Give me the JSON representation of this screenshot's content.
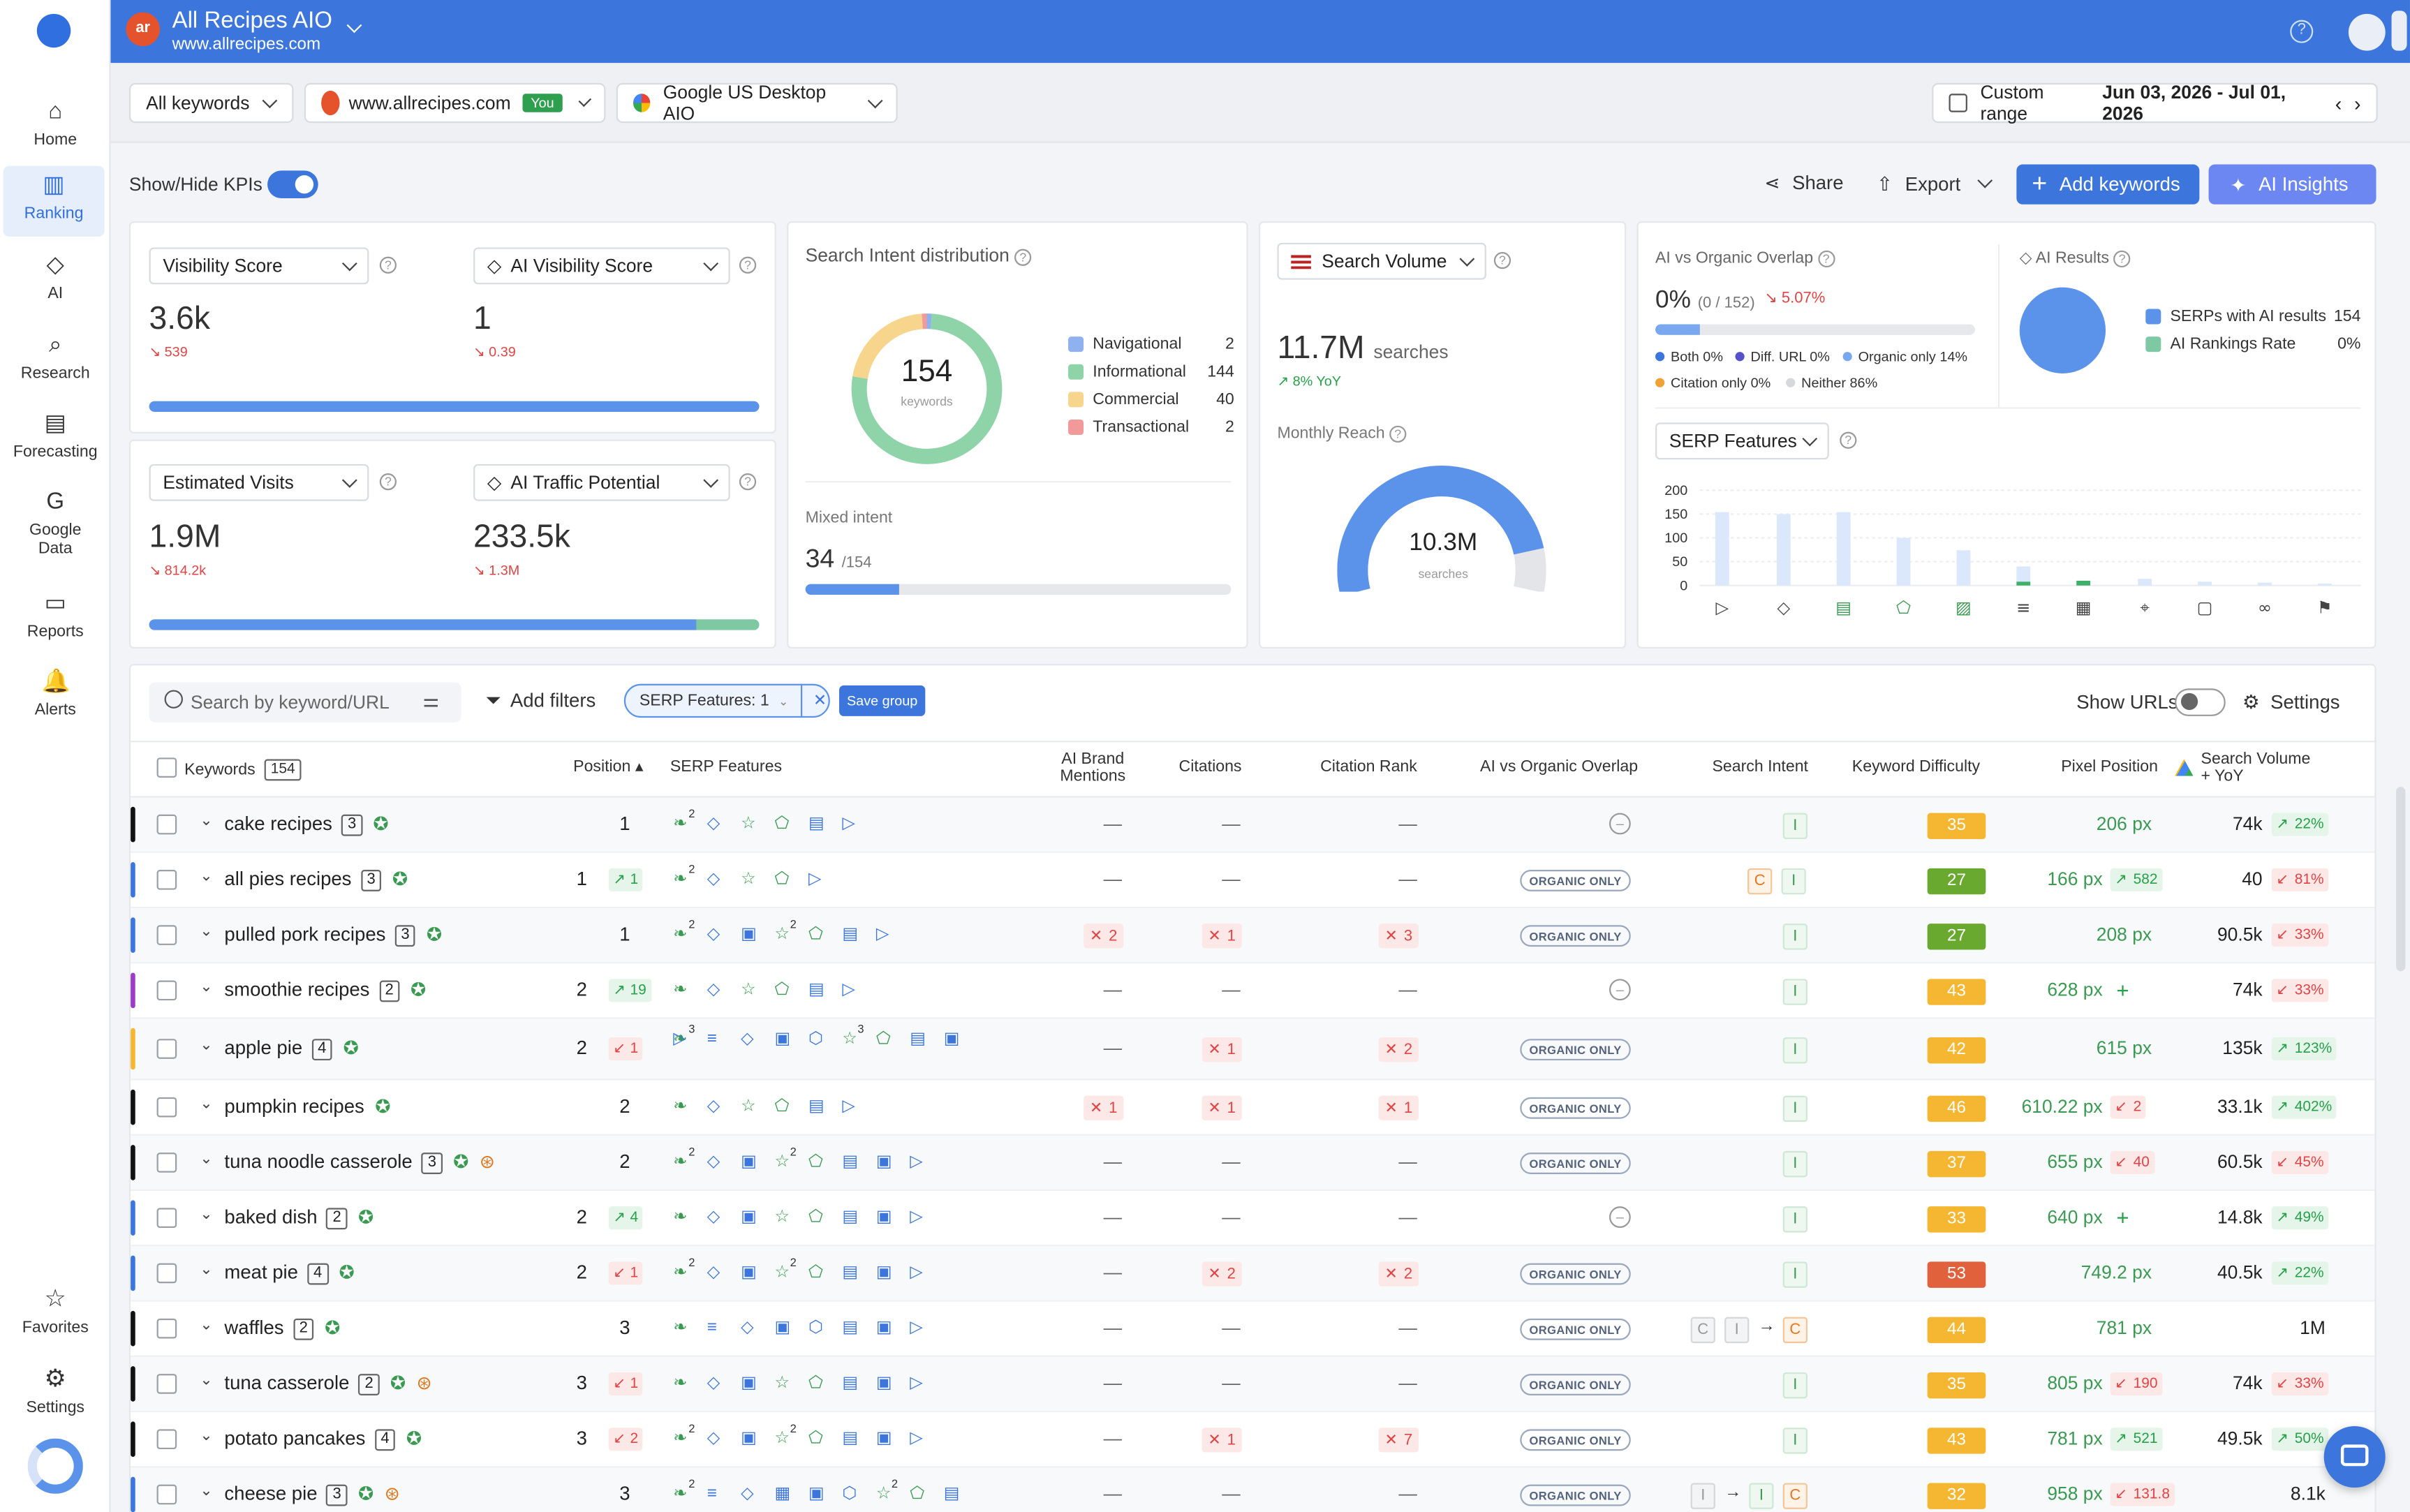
{
  "nav": {
    "items": [
      {
        "label": "Home",
        "icon": "home-icon"
      },
      {
        "label": "Ranking",
        "icon": "ranking-icon"
      },
      {
        "label": "AI",
        "icon": "ai-icon"
      },
      {
        "label": "Research",
        "icon": "research-icon"
      },
      {
        "label": "Forecasting",
        "icon": "forecasting-icon"
      },
      {
        "label": "Google\nData",
        "icon": "google-icon"
      },
      {
        "label": "Reports",
        "icon": "reports-icon"
      },
      {
        "label": "Alerts",
        "icon": "bell-icon"
      }
    ],
    "bottom": [
      {
        "label": "Favorites",
        "icon": "star-icon"
      },
      {
        "label": "Settings",
        "icon": "gear-icon"
      }
    ]
  },
  "header": {
    "project": "All Recipes AIO",
    "domain": "www.allrecipes.com",
    "logo_text": "ar"
  },
  "filters": {
    "keywords": "All keywords",
    "site": "www.allrecipes.com",
    "you": "You",
    "engine": "Google US Desktop AIO",
    "range_label": "Custom range",
    "range_value": "Jun 03, 2026 - Jul 01, 2026"
  },
  "toolbar": {
    "kpi_toggle": "Show/Hide KPIs",
    "share": "Share",
    "export": "Export",
    "add_keywords": "Add keywords",
    "ai_insights": "AI Insights"
  },
  "kpis": {
    "visibility": {
      "label": "Visibility Score",
      "value": "3.6k",
      "delta": "539"
    },
    "ai_visibility": {
      "label": "AI Visibility Score",
      "value": "1",
      "delta": "0.39"
    },
    "visibility_bar": 1.0,
    "visits": {
      "label": "Estimated Visits",
      "value": "1.9M",
      "delta": "814.2k"
    },
    "traffic": {
      "label": "AI Traffic Potential",
      "value": "233.5k",
      "delta": "1.3M"
    },
    "visits_bar": 0.897,
    "intent": {
      "title": "Search Intent distribution",
      "total": "154",
      "total_label": "keywords",
      "mixed_label": "Mixed intent",
      "mixed_value": "34",
      "mixed_total": "/154",
      "mixed_frac": 0.22,
      "items": [
        {
          "name": "Navigational",
          "value": "2",
          "color": "#8fb1ef"
        },
        {
          "name": "Informational",
          "value": "144",
          "color": "#8fd3a8"
        },
        {
          "name": "Commercial",
          "value": "40",
          "color": "#f7d58c"
        },
        {
          "name": "Transactional",
          "value": "2",
          "color": "#f29a9a"
        }
      ]
    },
    "volume": {
      "label": "Search Volume",
      "value": "11.7M",
      "unit": "searches",
      "yoy": "8% YoY",
      "reach_label": "Monthly Reach",
      "reach_value": "10.3M",
      "reach_unit": "searches",
      "reach_frac": 0.88
    },
    "overlap": {
      "title": "AI vs Organic Overlap",
      "value": "0%",
      "sub": "(0 / 152)",
      "delta": "5.07%",
      "frac": 0.14,
      "legend": [
        {
          "name": "Both 0%",
          "color": "#3c76dd"
        },
        {
          "name": "Diff. URL 0%",
          "color": "#5452c9"
        },
        {
          "name": "Organic only 14%",
          "color": "#7aa8ee"
        },
        {
          "name": "Citation only 0%",
          "color": "#f0a236"
        },
        {
          "name": "Neither 86%",
          "color": "#d6d8dc"
        }
      ]
    },
    "ai_results": {
      "title": "AI Results",
      "items": [
        {
          "name": "SERPs with AI results",
          "value": "154",
          "color": "#5b93ea"
        },
        {
          "name": "AI Rankings Rate",
          "value": "0%",
          "color": "#7ec9a3"
        }
      ]
    },
    "serp_features": {
      "label": "SERP Features",
      "yticks": [
        "200",
        "150",
        "100",
        "50",
        "0"
      ]
    }
  },
  "table": {
    "search_placeholder": "Search by keyword/URL",
    "add_filters": "Add filters",
    "filter_chip": "SERP Features: 1",
    "save_group": "Save group",
    "show_urls": "Show URLs",
    "settings": "Settings",
    "headers": {
      "keywords": "Keywords",
      "kw_count": "154",
      "position": "Position",
      "serp": "SERP Features",
      "brand": "AI Brand Mentions",
      "citations": "Citations",
      "citation_rank": "Citation Rank",
      "overlap": "AI vs Organic Overlap",
      "intent": "Search Intent",
      "kd": "Keyword Difficulty",
      "pixel": "Pixel Position",
      "volume": "Search Volume + YoY"
    },
    "organic_label": "ORGANIC ONLY",
    "rows": [
      {
        "kw": "cake recipes",
        "n": "3",
        "color": "#111",
        "pos": "1",
        "posChg": null,
        "brand": null,
        "cit": null,
        "crank": null,
        "overlap": "none",
        "intent": [
          "I"
        ],
        "kd": "35",
        "kdColor": "#f5b731",
        "px": "206 px",
        "pxChg": null,
        "vol": "74k",
        "volChg": {
          "t": "22%",
          "d": "u"
        }
      },
      {
        "kw": "all pies recipes",
        "n": "3",
        "color": "#3c76dd",
        "pos": "1",
        "posChg": {
          "t": "1",
          "d": "u"
        },
        "brand": null,
        "cit": null,
        "crank": null,
        "overlap": "org",
        "intent": [
          "C",
          "I"
        ],
        "kd": "27",
        "kdColor": "#6aa92f",
        "px": "166 px",
        "pxChg": {
          "t": "582",
          "d": "u"
        },
        "vol": "40",
        "volChg": {
          "t": "81%",
          "d": "d"
        }
      },
      {
        "kw": "pulled pork recipes",
        "n": "3",
        "color": "#3c76dd",
        "pos": "1",
        "posChg": null,
        "brand": "2",
        "cit": "1",
        "crank": "3",
        "overlap": "org",
        "intent": [
          "I"
        ],
        "kd": "27",
        "kdColor": "#6aa92f",
        "px": "208 px",
        "pxChg": null,
        "vol": "90.5k",
        "volChg": {
          "t": "33%",
          "d": "d"
        }
      },
      {
        "kw": "smoothie recipes",
        "n": "2",
        "color": "#9b3bc6",
        "pos": "2",
        "posChg": {
          "t": "19",
          "d": "u"
        },
        "brand": null,
        "cit": null,
        "crank": null,
        "overlap": "none",
        "intent": [
          "I"
        ],
        "kd": "43",
        "kdColor": "#f5b731",
        "px": "628 px",
        "pxChg": {
          "t": "+",
          "d": "u"
        },
        "vol": "74k",
        "volChg": {
          "t": "33%",
          "d": "d"
        }
      },
      {
        "kw": "apple pie",
        "n": "4",
        "color": "#f5b731",
        "pos": "2",
        "posChg": {
          "t": "1",
          "d": "d"
        },
        "brand": null,
        "cit": "1",
        "crank": "2",
        "overlap": "org",
        "intent": [
          "I"
        ],
        "kd": "42",
        "kdColor": "#f5b731",
        "px": "615 px",
        "pxChg": null,
        "vol": "135k",
        "volChg": {
          "t": "123%",
          "d": "u"
        }
      },
      {
        "kw": "pumpkin recipes",
        "n": "",
        "color": "#111",
        "pos": "2",
        "posChg": null,
        "brand": "1",
        "cit": "1",
        "crank": "1",
        "overlap": "org",
        "intent": [
          "I"
        ],
        "kd": "46",
        "kdColor": "#f5b731",
        "px": "610.22 px",
        "pxChg": {
          "t": "2",
          "d": "d"
        },
        "vol": "33.1k",
        "volChg": {
          "t": "402%",
          "d": "u"
        }
      },
      {
        "kw": "tuna noodle casserole",
        "n": "3",
        "color": "#111",
        "pos": "2",
        "posChg": null,
        "brand": null,
        "cit": null,
        "crank": null,
        "overlap": "org",
        "intent": [
          "I"
        ],
        "kd": "37",
        "kdColor": "#f5b731",
        "px": "655 px",
        "pxChg": {
          "t": "40",
          "d": "d"
        },
        "vol": "60.5k",
        "volChg": {
          "t": "45%",
          "d": "d"
        }
      },
      {
        "kw": "baked dish",
        "n": "2",
        "color": "#3c76dd",
        "pos": "2",
        "posChg": {
          "t": "4",
          "d": "u"
        },
        "brand": null,
        "cit": null,
        "crank": null,
        "overlap": "none",
        "intent": [
          "I"
        ],
        "kd": "33",
        "kdColor": "#f5b731",
        "px": "640 px",
        "pxChg": {
          "t": "+",
          "d": "u"
        },
        "vol": "14.8k",
        "volChg": {
          "t": "49%",
          "d": "u"
        }
      },
      {
        "kw": "meat pie",
        "n": "4",
        "color": "#3c76dd",
        "pos": "2",
        "posChg": {
          "t": "1",
          "d": "d"
        },
        "brand": null,
        "cit": "2",
        "crank": "2",
        "overlap": "org",
        "intent": [
          "I"
        ],
        "kd": "53",
        "kdColor": "#e2613d",
        "px": "749.2 px",
        "pxChg": null,
        "vol": "40.5k",
        "volChg": {
          "t": "22%",
          "d": "u"
        }
      },
      {
        "kw": "waffles",
        "n": "2",
        "color": "#111",
        "pos": "3",
        "posChg": null,
        "brand": null,
        "cit": null,
        "crank": null,
        "overlap": "org",
        "intent": [
          "gC",
          "gI",
          "→",
          "C"
        ],
        "kd": "44",
        "kdColor": "#f5b731",
        "px": "781 px",
        "pxChg": null,
        "vol": "1M",
        "volChg": null
      },
      {
        "kw": "tuna casserole",
        "n": "2",
        "color": "#111",
        "pos": "3",
        "posChg": {
          "t": "1",
          "d": "d"
        },
        "brand": null,
        "cit": null,
        "crank": null,
        "overlap": "org",
        "intent": [
          "I"
        ],
        "kd": "35",
        "kdColor": "#f5b731",
        "px": "805 px",
        "pxChg": {
          "t": "190",
          "d": "d"
        },
        "vol": "74k",
        "volChg": {
          "t": "33%",
          "d": "d"
        }
      },
      {
        "kw": "potato pancakes",
        "n": "4",
        "color": "#111",
        "pos": "3",
        "posChg": {
          "t": "2",
          "d": "d"
        },
        "brand": null,
        "cit": "1",
        "crank": "7",
        "overlap": "org",
        "intent": [
          "I"
        ],
        "kd": "43",
        "kdColor": "#f5b731",
        "px": "781 px",
        "pxChg": {
          "t": "521",
          "d": "u"
        },
        "vol": "49.5k",
        "volChg": {
          "t": "50%",
          "d": "u"
        }
      },
      {
        "kw": "cheese pie",
        "n": "3",
        "color": "#3c76dd",
        "pos": "3",
        "posChg": null,
        "brand": null,
        "cit": null,
        "crank": null,
        "overlap": "org",
        "intent": [
          "gI",
          "→",
          "I",
          "C"
        ],
        "kd": "32",
        "kdColor": "#f5b731",
        "px": "958 px",
        "pxChg": {
          "t": "131.8",
          "d": "d"
        },
        "vol": "8.1k",
        "volChg": null
      }
    ]
  }
}
